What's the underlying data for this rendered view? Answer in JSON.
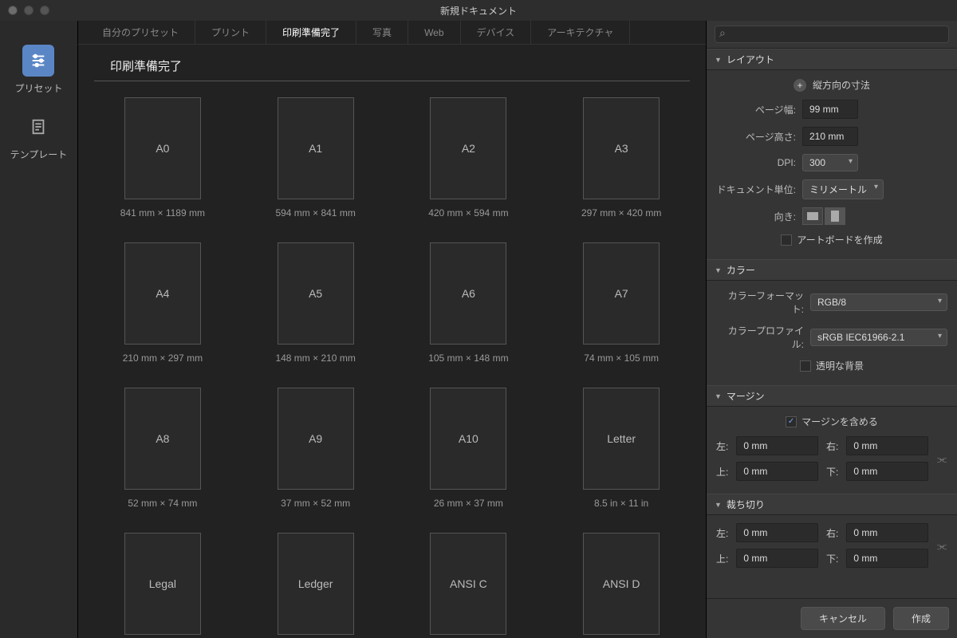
{
  "title": "新規ドキュメント",
  "left": {
    "presets": "プリセット",
    "templates": "テンプレート"
  },
  "tabs": [
    "自分のプリセット",
    "プリント",
    "印刷準備完了",
    "写真",
    "Web",
    "デバイス",
    "アーキテクチャ"
  ],
  "active_tab": 2,
  "section_title": "印刷準備完了",
  "presets": [
    {
      "name": "A0",
      "dim": "841 mm × 1189 mm"
    },
    {
      "name": "A1",
      "dim": "594 mm × 841 mm"
    },
    {
      "name": "A2",
      "dim": "420 mm × 594 mm"
    },
    {
      "name": "A3",
      "dim": "297 mm × 420 mm"
    },
    {
      "name": "A4",
      "dim": "210 mm × 297 mm"
    },
    {
      "name": "A5",
      "dim": "148 mm × 210 mm"
    },
    {
      "name": "A6",
      "dim": "105 mm × 148 mm"
    },
    {
      "name": "A7",
      "dim": "74 mm × 105 mm"
    },
    {
      "name": "A8",
      "dim": "52 mm × 74 mm"
    },
    {
      "name": "A9",
      "dim": "37 mm × 52 mm"
    },
    {
      "name": "A10",
      "dim": "26 mm × 37 mm"
    },
    {
      "name": "Letter",
      "dim": "8.5 in × 11 in"
    },
    {
      "name": "Legal",
      "dim": ""
    },
    {
      "name": "Ledger",
      "dim": ""
    },
    {
      "name": "ANSI C",
      "dim": ""
    },
    {
      "name": "ANSI D",
      "dim": ""
    }
  ],
  "panels": {
    "layout": {
      "title": "レイアウト",
      "portrait_dim": "縦方向の寸法",
      "page_width_label": "ページ幅:",
      "page_width": "99 mm",
      "page_height_label": "ページ高さ:",
      "page_height": "210 mm",
      "dpi_label": "DPI:",
      "dpi": "300",
      "unit_label": "ドキュメント単位:",
      "unit": "ミリメートル",
      "orient_label": "向き:",
      "artboard": "アートボードを作成"
    },
    "color": {
      "title": "カラー",
      "format_label": "カラーフォーマット:",
      "format": "RGB/8",
      "profile_label": "カラープロファイル:",
      "profile": "sRGB IEC61966-2.1",
      "transparent": "透明な背景"
    },
    "margin": {
      "title": "マージン",
      "include": "マージンを含める",
      "left": "左:",
      "right": "右:",
      "top": "上:",
      "bottom": "下:",
      "v_left": "0 mm",
      "v_right": "0 mm",
      "v_top": "0 mm",
      "v_bottom": "0 mm"
    },
    "bleed": {
      "title": "裁ち切り",
      "left": "左:",
      "right": "右:",
      "top": "上:",
      "bottom": "下:",
      "v_left": "0 mm",
      "v_right": "0 mm",
      "v_top": "0 mm",
      "v_bottom": "0 mm"
    }
  },
  "footer": {
    "cancel": "キャンセル",
    "create": "作成"
  }
}
